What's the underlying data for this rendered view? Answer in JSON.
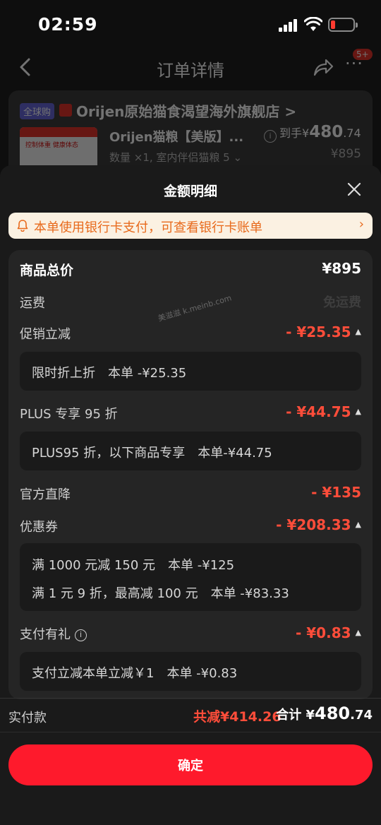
{
  "status_bar": {
    "time": "02:59"
  },
  "nav": {
    "title": "订单详情",
    "badge": "5+"
  },
  "store": {
    "tag": "全球购",
    "name": "Orijen原始猫食渴望海外旗舰店 >",
    "product_title": "Orijen猫粮【美版】...",
    "product_spec": "数量 ×1, 室内伴侣猫粮 5 ⌄",
    "price_prefix": "到手¥",
    "price_main": "480",
    "price_dec": ".74",
    "price_orig": "¥895"
  },
  "sheet": {
    "title": "金额明细",
    "notice": "本单使用银行卡支付，可查看银行卡账单",
    "watermark": "美滋滋 k.meinb.com",
    "rows": {
      "total": {
        "label": "商品总价",
        "value": "¥895"
      },
      "shipping": {
        "label": "运费",
        "value": "免运费"
      },
      "promo": {
        "label": "促销立减",
        "value": "- ¥25.35",
        "detail": "限时折上折　本单 -¥25.35"
      },
      "plus": {
        "label": "PLUS 专享 95 折",
        "value": "- ¥44.75",
        "detail": "PLUS95 折，以下商品专享　本单-¥44.75"
      },
      "official": {
        "label": "官方直降",
        "value": "- ¥135"
      },
      "coupon": {
        "label": "优惠券",
        "value": "- ¥208.33",
        "detail1": "满 1000 元减 150 元　本单 -¥125",
        "detail2": "满 1 元 9 折，最高减 100 元　本单 -¥83.33"
      },
      "gift": {
        "label": "支付有礼",
        "value": "- ¥0.83",
        "detail": "支付立减本单立减￥1　本单 -¥0.83"
      }
    },
    "footer": {
      "pay_label": "实付款",
      "save": "共减¥414.26",
      "sum_prefix": "合计 ¥",
      "sum_main": "480",
      "sum_dec": ".74",
      "confirm": "确定"
    }
  },
  "colors": {
    "accent": "#fe1a2c",
    "discount": "#ff4d3a",
    "notice_text": "#e86a1c"
  }
}
